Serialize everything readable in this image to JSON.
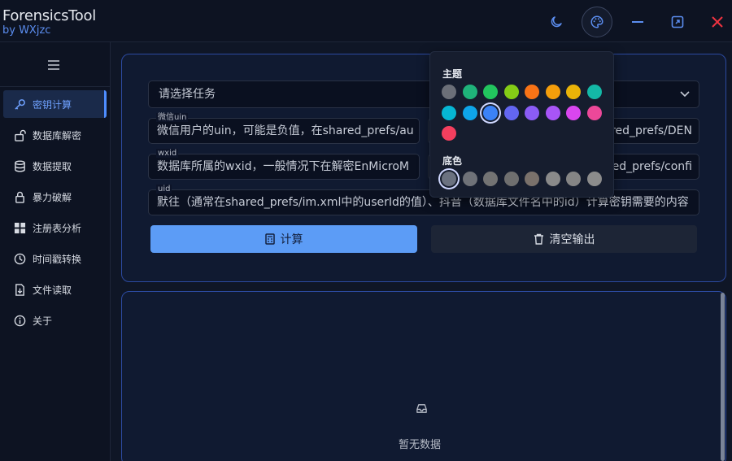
{
  "app": {
    "title": "ForensicsTool",
    "subtitle": "by WXjzc"
  },
  "titlebar": {
    "icons": [
      "moon-icon",
      "palette-icon",
      "minimize-icon",
      "maximize-icon",
      "close-icon"
    ]
  },
  "sidebar": {
    "items": [
      {
        "label": "密钥计算",
        "icon": "key-icon",
        "active": true
      },
      {
        "label": "数据库解密",
        "icon": "unlock-icon"
      },
      {
        "label": "数据提取",
        "icon": "database-icon"
      },
      {
        "label": "暴力破解",
        "icon": "lock-icon"
      },
      {
        "label": "注册表分析",
        "icon": "grid-icon"
      },
      {
        "label": "时间戳转换",
        "icon": "clock-icon"
      },
      {
        "label": "文件读取",
        "icon": "file-icon"
      },
      {
        "label": "关于",
        "icon": "info-icon"
      }
    ]
  },
  "form": {
    "task_placeholder": "请选择任务",
    "uin_label": "微信uin",
    "uin_text": "微信用户的uin，可能是负值，在shared_prefs/au",
    "uin_right_text": "red_prefs/DEN",
    "wxid_label": "wxid",
    "wxid_text": "数据库所属的wxid，一般情况下在解密EnMicroM",
    "wxid_right_text": "ed_prefs/confi",
    "uid_label": "uid",
    "uid_text": "默往（通常在shared_prefs/im.xml中的userId的值）、抖音（数据库文件名中的id）计算密钥需要的内容",
    "calc_label": "计算",
    "clear_label": "清空输出"
  },
  "output": {
    "empty_text": "暂无数据"
  },
  "popover": {
    "theme_title": "主题",
    "base_title": "底色",
    "theme_colors": [
      "#6b6f78",
      "#1fb37a",
      "#22c55e",
      "#84cc16",
      "#f97316",
      "#f59e0b",
      "#eab308",
      "#14b8a6",
      "#06b6d4",
      "#0ea5e9",
      "#3b82f6",
      "#6366f1",
      "#8b5cf6",
      "#a855f7",
      "#d946ef",
      "#ec4899",
      "#f43f5e"
    ],
    "theme_selected": 10,
    "base_colors": [
      "#6b7280",
      "#6f7278",
      "#737373",
      "#6f6f6f",
      "#7a716b",
      "#8a8a8a",
      "#858585",
      "#8c8c8c"
    ],
    "base_selected": 0
  }
}
